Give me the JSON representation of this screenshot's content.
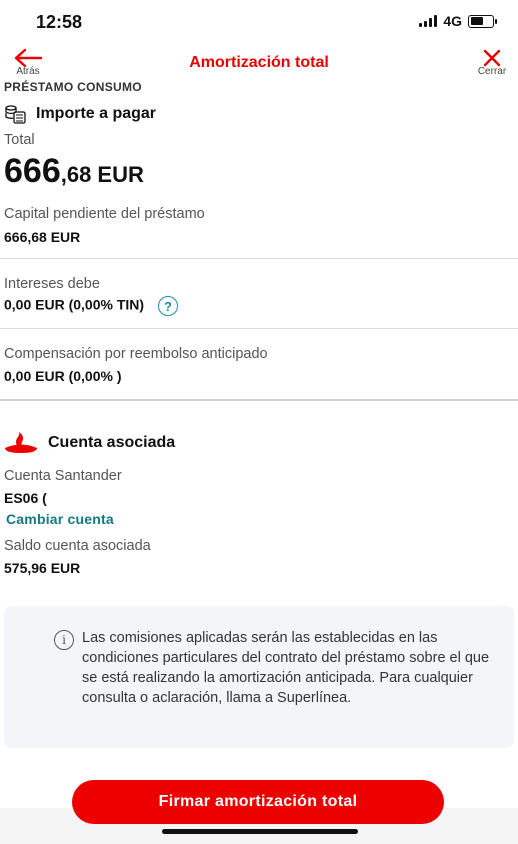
{
  "status_bar": {
    "time": "12:58",
    "network": "4G",
    "battery_level": 0.6
  },
  "nav": {
    "back_label": "Atrás",
    "title": "Amortización total",
    "close_label": "Cerrar"
  },
  "section_label": "PRÉSTAMO CONSUMO",
  "importe": {
    "title": "Importe a pagar",
    "total_label": "Total",
    "total_int": "666",
    "total_rest": ",68 EUR",
    "capital_label": "Capital pendiente del préstamo",
    "capital_value": "666,68 EUR",
    "intereses_label": "Intereses debe",
    "intereses_value": "0,00 EUR",
    "intereses_rate": "(0,00% TIN)",
    "compensacion_label": "Compensación por reembolso anticipado",
    "compensacion_value": "0,00 EUR",
    "compensacion_rate": "(0,00% )"
  },
  "cuenta": {
    "title": "Cuenta asociada",
    "account_label": "Cuenta Santander",
    "account_value": "ES06 (",
    "change_link": "Cambiar cuenta",
    "saldo_label": "Saldo cuenta asociada",
    "saldo_value": "575,96 EUR"
  },
  "info": {
    "text": "Las comisiones aplicadas serán las establecidas en las condiciones particulares del contrato del préstamo sobre el que se está realizando la amortización anticipada. Para cualquier consulta o aclaración, llama a Superlínea."
  },
  "cta": {
    "label": "Firmar amortización total"
  },
  "colors": {
    "brand": "#ec0000",
    "link": "#127a85",
    "help": "#1b8fb0"
  },
  "icons": [
    "back-arrow-icon",
    "close-icon",
    "coins-icon",
    "help-icon",
    "santander-flame-icon",
    "info-icon"
  ]
}
